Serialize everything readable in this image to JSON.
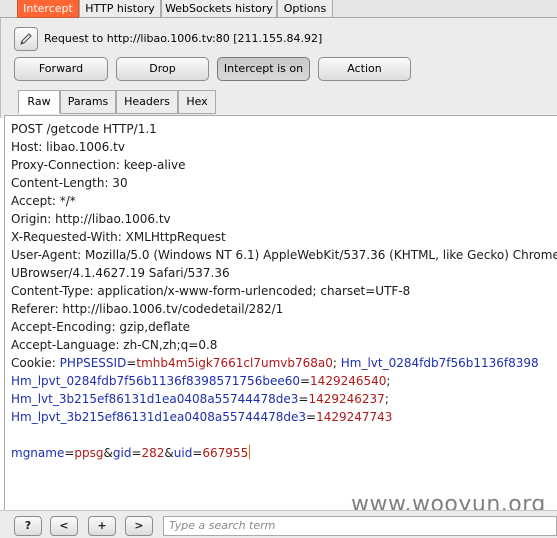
{
  "top_tabs": [
    "Intercept",
    "HTTP history",
    "WebSockets history",
    "Options"
  ],
  "request_label": "Request to http://libao.1006.tv:80  [211.155.84.92]",
  "buttons": {
    "forward": "Forward",
    "drop": "Drop",
    "intercept": "Intercept is on",
    "action": "Action"
  },
  "sub_tabs": [
    "Raw",
    "Params",
    "Headers",
    "Hex"
  ],
  "request_lines": [
    "POST /getcode HTTP/1.1",
    "Host: libao.1006.tv",
    "Proxy-Connection: keep-alive",
    "Content-Length: 30",
    "Accept: */*",
    "Origin: http://libao.1006.tv",
    "X-Requested-With: XMLHttpRequest",
    "User-Agent: Mozilla/5.0 (Windows NT 6.1) AppleWebKit/537.36 (KHTML, like Gecko) Chrome",
    "UBrowser/4.1.4627.19 Safari/537.36",
    "Content-Type: application/x-www-form-urlencoded; charset=UTF-8",
    "Referer: http://libao.1006.tv/codedetail/282/1",
    "Accept-Encoding: gzip,deflate",
    "Accept-Language: zh-CN,zh;q=0.8"
  ],
  "cookie": {
    "label": "Cookie: ",
    "line1": [
      {
        "name": "PHPSESSID",
        "value": "tmhb4m5igk7661cl7umvb768a0"
      },
      {
        "name": "Hm_lvt_0284fdb7f56b1136f8398",
        "value": ""
      }
    ],
    "line2": [
      {
        "name": "Hm_lpvt_0284fdb7f56b1136f8398571756bee60",
        "value": "1429246540"
      }
    ],
    "line3": [
      {
        "name": "Hm_lvt_3b215ef86131d1ea0408a55744478de3",
        "value": "1429246237"
      }
    ],
    "line4": [
      {
        "name": "Hm_lpvt_3b215ef86131d1ea0408a55744478de3",
        "value": "1429247743"
      }
    ]
  },
  "body_params": [
    {
      "name": "mgname",
      "value": "ppsg"
    },
    {
      "name": "gid",
      "value": "282"
    },
    {
      "name": "uid",
      "value": "667955"
    }
  ],
  "bottom": {
    "help": "?",
    "prev": "<",
    "add": "+",
    "next": ">",
    "search_placeholder": "Type a search term"
  },
  "watermark": "www.wooyun.org",
  "colors": {
    "accent_tab": "#ff6633",
    "param_name": "#1d2fb0",
    "param_value": "#b01818"
  }
}
